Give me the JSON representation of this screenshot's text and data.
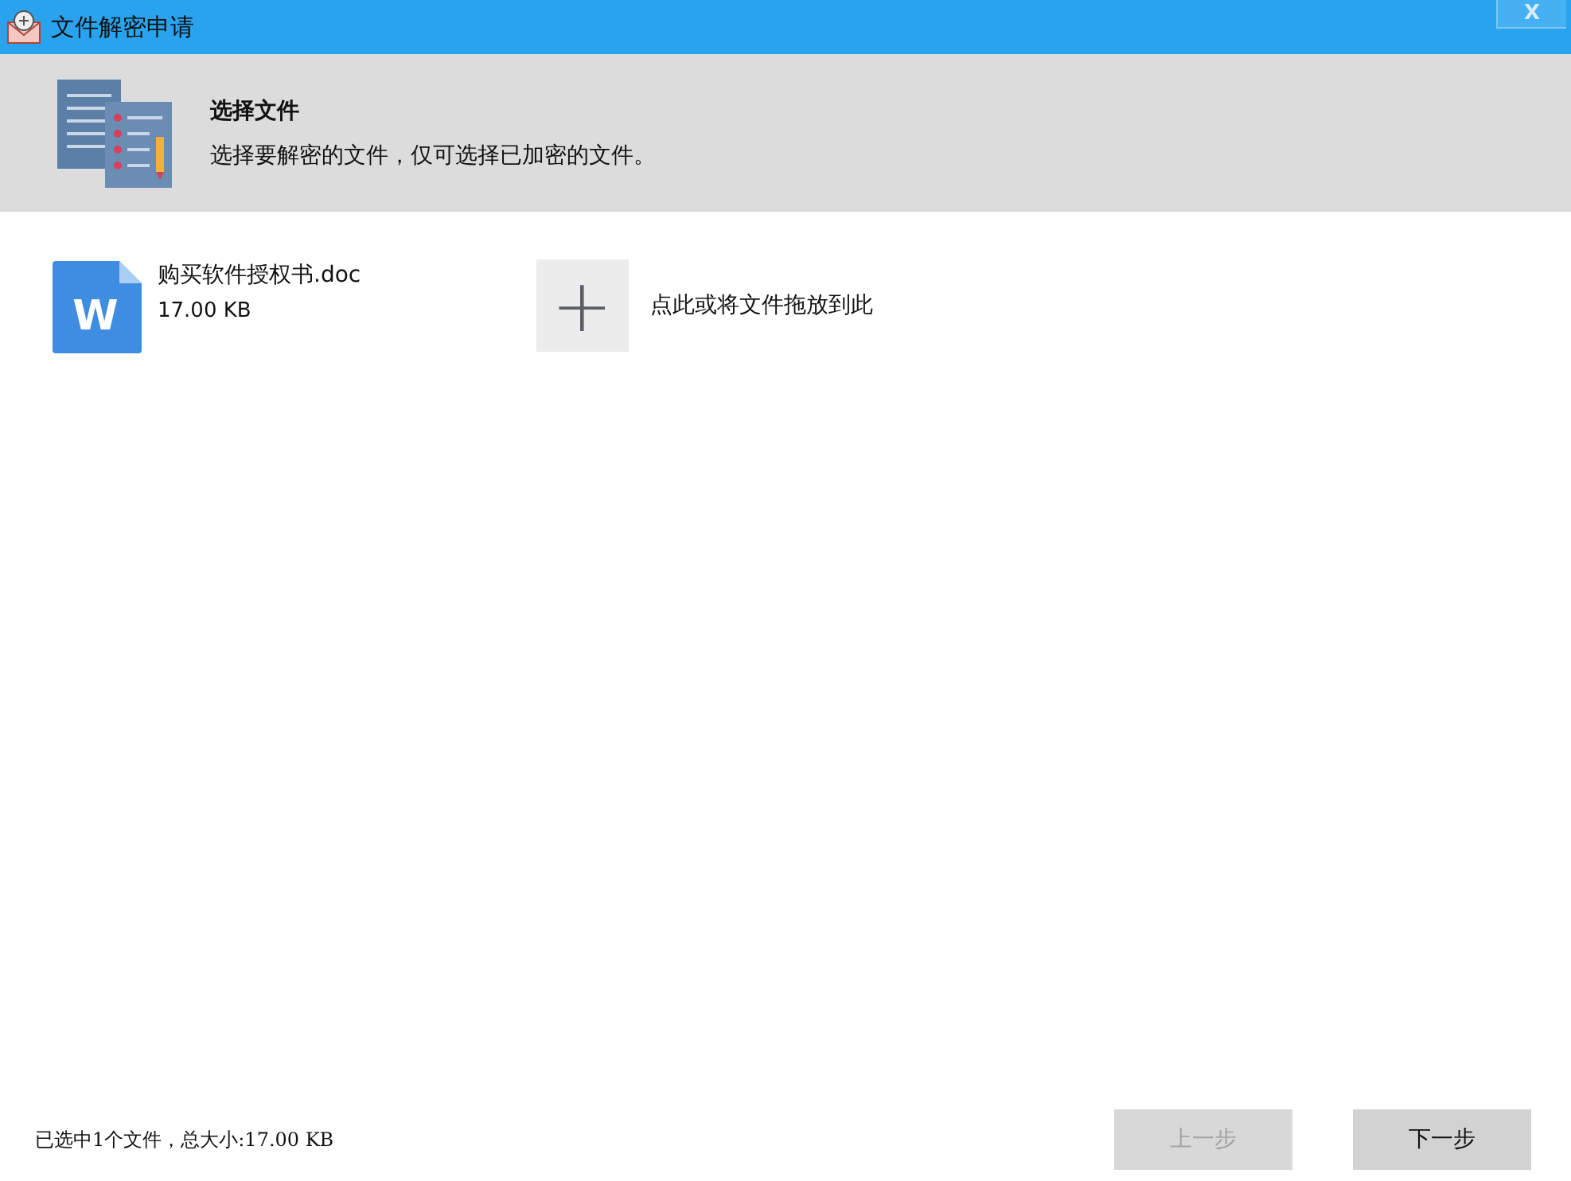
{
  "window": {
    "title": "文件解密申请",
    "close": "X"
  },
  "header": {
    "title": "选择文件",
    "subtitle": "选择要解密的文件，仅可选择已加密的文件。"
  },
  "files": [
    {
      "name": "购买软件授权书.doc",
      "size": "17.00 KB",
      "kind": "word",
      "badge": "W"
    }
  ],
  "add": {
    "icon": "+",
    "label": "点此或将文件拖放到此"
  },
  "status": "已选中1个文件，总大小:17.00 KB",
  "buttons": [
    {
      "label": "上一步",
      "disabled": true
    },
    {
      "label": "下一步",
      "disabled": false
    }
  ]
}
